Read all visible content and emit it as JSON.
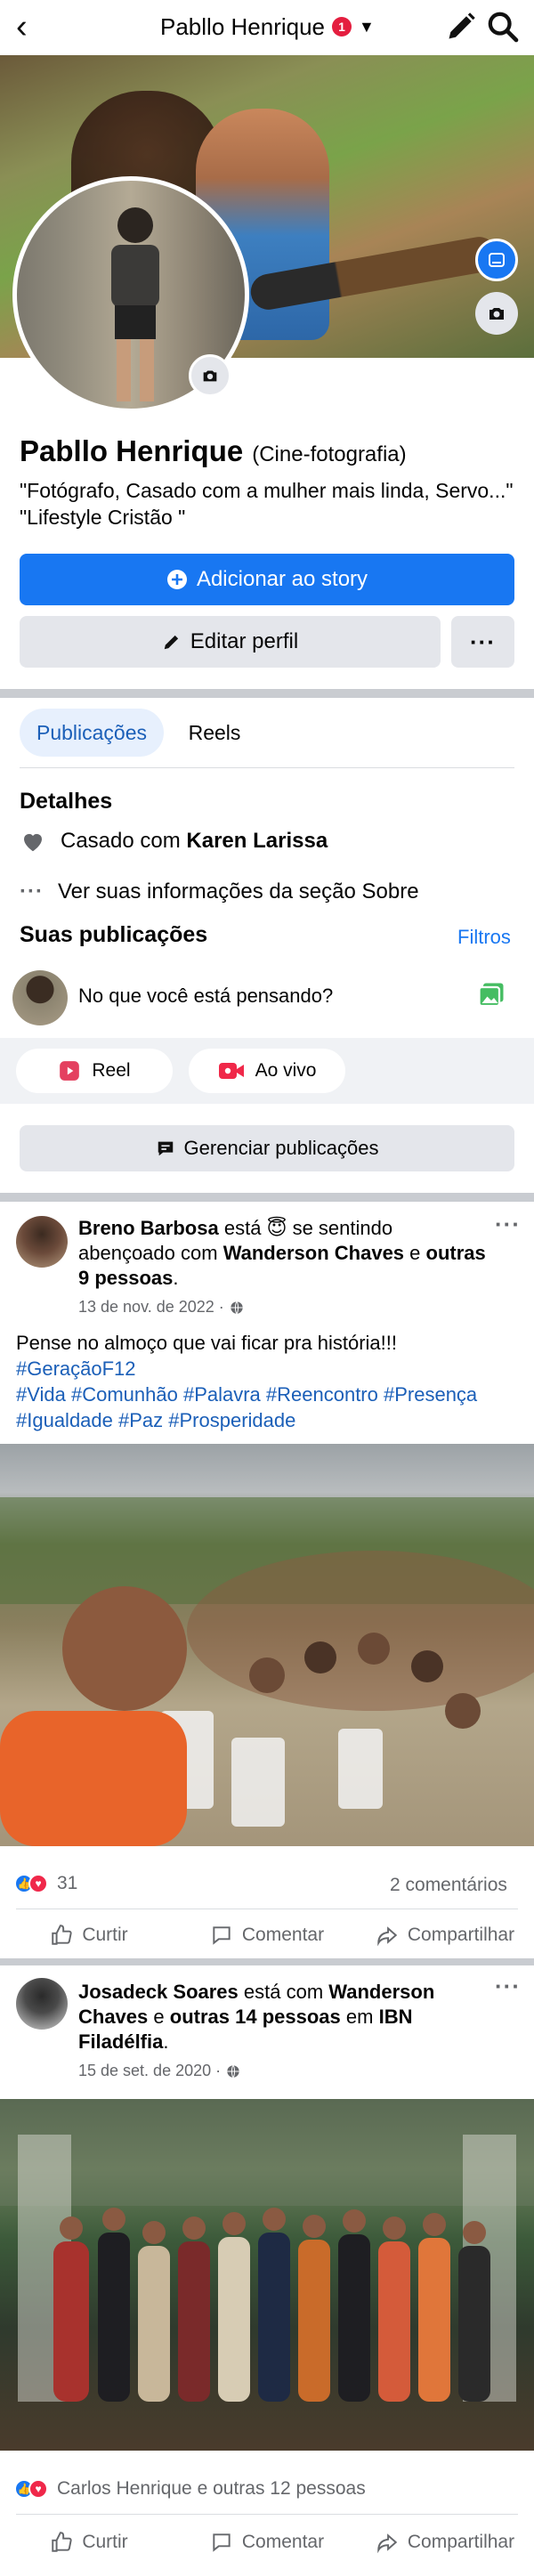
{
  "topbar": {
    "title": "Pabllo Henrique",
    "notification_count": "1"
  },
  "profile": {
    "name": "Pabllo Henrique",
    "category": "(Cine-fotografia)",
    "bio": "\"Fotógrafo, Casado com a mulher mais linda, Servo...\"      \"Lifestyle Cristão \"",
    "add_story_label": "Adicionar ao story",
    "edit_profile_label": "Editar perfil",
    "more_label": "···"
  },
  "tabs": [
    {
      "label": "Publicações"
    },
    {
      "label": "Reels"
    }
  ],
  "details": {
    "title": "Detalhes",
    "relationship_prefix": "Casado com",
    "relationship_name": "Karen Larissa",
    "about_label": "Ver suas informações da seção Sobre"
  },
  "posts_section": {
    "title": "Suas publicações",
    "filters_label": "Filtros",
    "composer_placeholder": "No que você está pensando?",
    "reel_label": "Reel",
    "live_label": "Ao vivo",
    "manage_label": "Gerenciar publicações"
  },
  "posts": [
    {
      "author": "Breno Barbosa",
      "verb": "está 😇 se sentindo abençoado com",
      "with": "Wanderson Chaves",
      "connector": "e",
      "others": "outras 9 pessoas",
      "suffix": ".",
      "date": "13 de nov. de 2022 ·",
      "text_line": "Pense no almoço que vai ficar pra história!!!",
      "hashtags_1": "#GeraçãoF12",
      "hashtags_2": "#Vida #Comunhão #Palavra #Reencontro #Presença",
      "hashtags_3": "#Igualdade #Paz #Prosperidade",
      "reaction_count": "31",
      "comments": "2 comentários"
    },
    {
      "author": "Josadeck Soares",
      "verb": "está com",
      "with": "Wanderson Chaves",
      "connector": "e",
      "others": "outras 14 pessoas",
      "place_prefix": "em",
      "place": "IBN Filadélfia",
      "suffix": ".",
      "date": "15 de set. de 2020 ·",
      "reactions_text": "Carlos Henrique e outras 12 pessoas"
    }
  ],
  "actions": {
    "like": "Curtir",
    "comment": "Comentar",
    "share": "Compartilhar"
  },
  "colors": {
    "primary": "#1877f2",
    "secondary_button": "#e4e6eb",
    "tab_active_bg": "#e7f0fd",
    "muted_text": "#65676b",
    "badge": "#e41e3f"
  },
  "icons": [
    "back-arrow-icon",
    "caret-down-icon",
    "pencil-icon",
    "search-icon",
    "camera-icon",
    "avatar-frame-icon",
    "plus-circle-icon",
    "heart-icon",
    "dots-icon",
    "photo-icon",
    "reel-icon",
    "live-video-icon",
    "manage-posts-icon",
    "globe-icon",
    "like-icon",
    "comment-icon",
    "share-icon"
  ]
}
